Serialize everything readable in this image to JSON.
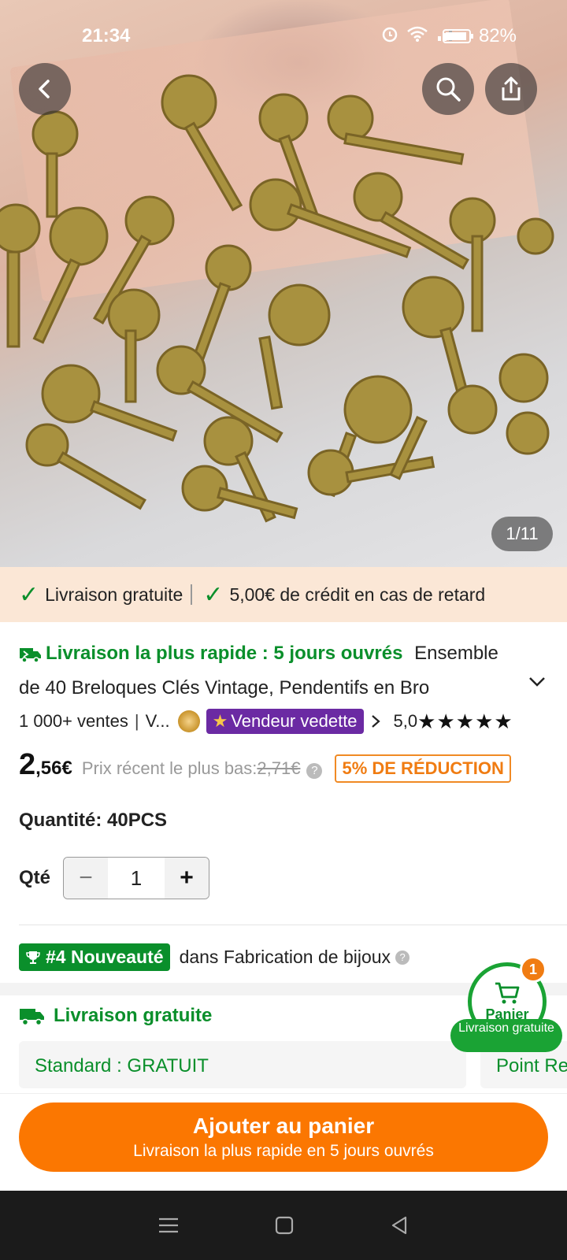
{
  "status_bar": {
    "time": "21:34",
    "battery": "82%"
  },
  "gallery": {
    "counter": "1/11"
  },
  "promo": {
    "item1": "Livraison gratuite",
    "item2": "5,00€ de crédit en cas de retard"
  },
  "product": {
    "fast_delivery": "Livraison la plus rapide : 5 jours ouvrés",
    "title_start": "Ensemble",
    "title_line2": "de 40 Breloques Clés Vintage, Pendentifs en Bro",
    "sales": "1 000+ ventes",
    "seller_short": "V...",
    "featured_badge": "Vendeur vedette",
    "rating": "5,0",
    "stars": "★★★★★",
    "price_main": "2",
    "price_rest": ",56€",
    "recent_label": "Prix récent le plus bas:",
    "recent_price": "2,71€",
    "discount": "5% DE RÉDUCTION",
    "quantity_label": "Quantité: 40PCS",
    "qty_short": "Qté",
    "qty_value": "1",
    "rank_tag": "#4 Nouveauté",
    "rank_text": "dans Fabrication de bijoux"
  },
  "shipping": {
    "header": "Livraison gratuite",
    "standard": "Standard : GRATUIT",
    "point": "Point Re"
  },
  "cart": {
    "label": "Panier",
    "count": "1",
    "pill": "Livraison gratuite"
  },
  "cta": {
    "main": "Ajouter au panier",
    "sub": "Livraison la plus rapide en 5 jours ouvrés"
  },
  "colors": {
    "accent": "#fb7701",
    "green": "#0a8f2b",
    "purple": "#6b2aa3"
  }
}
